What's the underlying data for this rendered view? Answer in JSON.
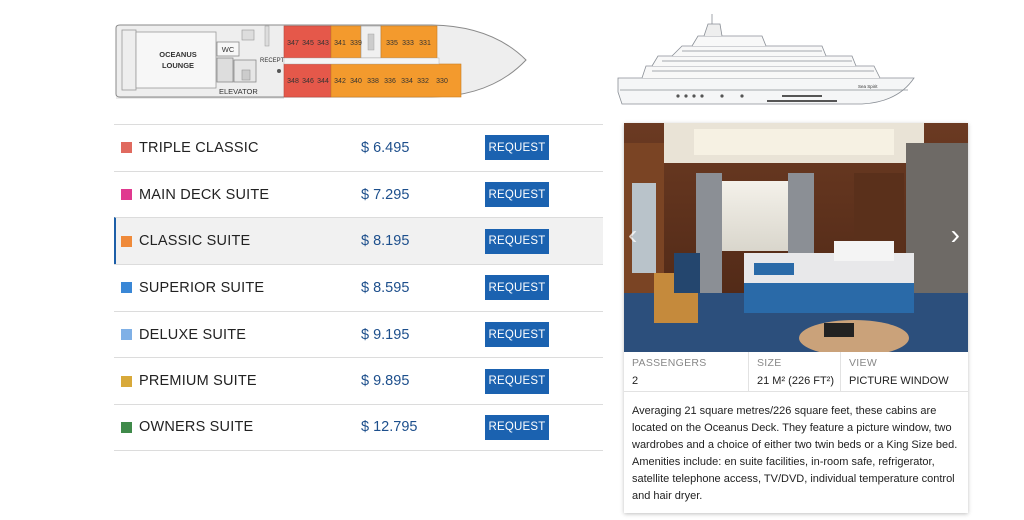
{
  "deck_plan": {
    "lounge_label_1": "OCEANUS",
    "lounge_label_2": "LOUNGE",
    "wc_label": "WC",
    "reception_label": "RECEPTION",
    "elevator_label": "ELEVATOR",
    "top_cabins": [
      "347",
      "345",
      "343",
      "341",
      "339",
      "335",
      "333",
      "331"
    ],
    "bottom_cabins": [
      "348",
      "346",
      "344",
      "342",
      "340",
      "338",
      "336",
      "334",
      "332",
      "330"
    ]
  },
  "ship_profile": {
    "name": "Sea Spirit"
  },
  "cabins": [
    {
      "name": "TRIPLE CLASSIC",
      "price": "$ 6.495",
      "button": "REQUEST",
      "color": "#e06a5f"
    },
    {
      "name": "MAIN DECK SUITE",
      "price": "$ 7.295",
      "button": "REQUEST",
      "color": "#e0398f"
    },
    {
      "name": "CLASSIC SUITE",
      "price": "$ 8.195",
      "button": "REQUEST",
      "color": "#ef8a3a",
      "active": true
    },
    {
      "name": "SUPERIOR SUITE",
      "price": "$ 8.595",
      "button": "REQUEST",
      "color": "#3a87d6"
    },
    {
      "name": "DELUXE SUITE",
      "price": "$ 9.195",
      "button": "REQUEST",
      "color": "#7fb0e6"
    },
    {
      "name": "PREMIUM SUITE",
      "price": "$ 9.895",
      "button": "REQUEST",
      "color": "#d8a93a"
    },
    {
      "name": "OWNERS SUITE",
      "price": "$ 12.795",
      "button": "REQUEST",
      "color": "#3f8a4a"
    }
  ],
  "detail": {
    "passengers_label": "PASSENGERS",
    "passengers_value": "2",
    "size_label": "SIZE",
    "size_value": "21 M² (226 FT²)",
    "view_label": "VIEW",
    "view_value": "PICTURE WINDOW",
    "description": "Averaging 21 square metres/226 square feet, these cabins are located on the Oceanus Deck. They feature a picture window, two wardrobes and a choice of either two twin beds or a King Size bed. Amenities include: en suite facilities, in-room safe, refrigerator, satellite telephone access, TV/DVD, individual temperature control and hair dryer."
  },
  "icons": {
    "prev": "chevron-left-icon",
    "next": "chevron-right-icon"
  }
}
